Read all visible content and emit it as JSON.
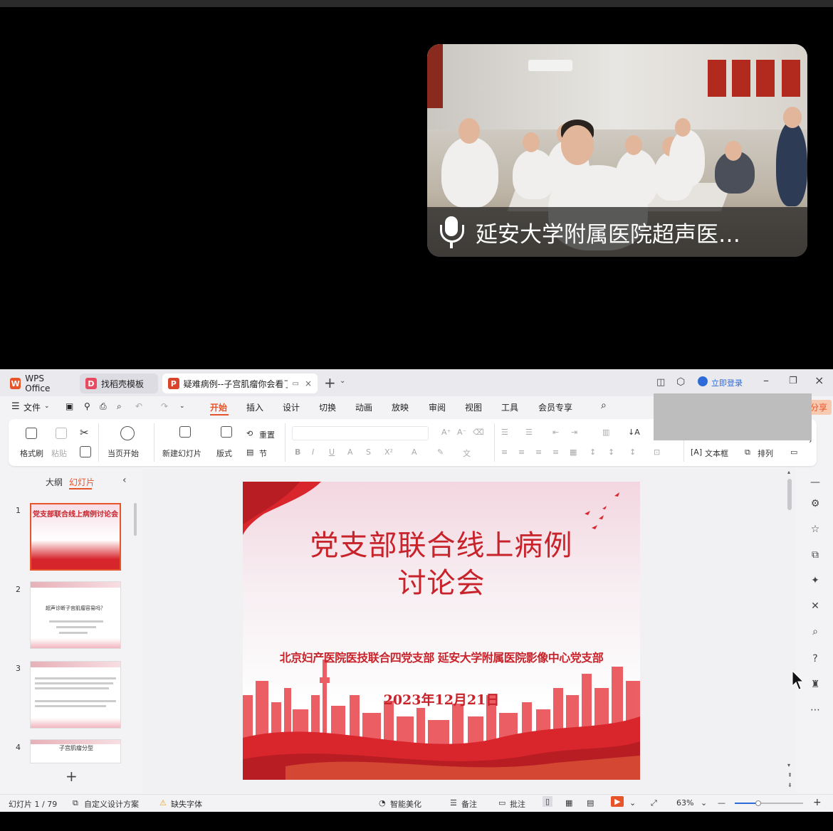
{
  "video": {
    "participant_name": "延安大学附属医院超声医…"
  },
  "tabs": [
    {
      "label": "WPS Office"
    },
    {
      "label": "找稻壳模板"
    },
    {
      "label": "疑难病例--子宫肌瘤你会看了吗"
    }
  ],
  "titlebar": {
    "login": "立即登录"
  },
  "menu": {
    "file": "文件",
    "items": [
      "开始",
      "插入",
      "设计",
      "切换",
      "动画",
      "放映",
      "审阅",
      "视图",
      "工具",
      "会员专享"
    ],
    "share": "分享"
  },
  "ribbon": {
    "format_painter": "格式刷",
    "paste": "粘贴",
    "from_current": "当页开始",
    "new_slide": "新建幻灯片",
    "layout": "版式",
    "reset": "重置",
    "section": "节",
    "textbox": "文本框",
    "arrange": "排列"
  },
  "left_panel": {
    "outline_tab": "大纲",
    "slides_tab": "幻灯片",
    "thumbnails": [
      {
        "num": "1",
        "title": "党支部联合线上病例讨论会"
      },
      {
        "num": "2",
        "title": "超声诊断子宫肌瘤容易吗？"
      },
      {
        "num": "3",
        "title": ""
      },
      {
        "num": "4",
        "title": "子宫肌瘤分型"
      }
    ]
  },
  "slide": {
    "title_line1": "党支部联合线上病例",
    "title_line2": "讨论会",
    "subtitle": "北京妇产医院医技联合四党支部  延安大学附属医院影像中心党支部",
    "date": "2023年12月21日"
  },
  "status": {
    "slide_count": "幻灯片 1 / 79",
    "design": "自定义设计方案",
    "missing_font": "缺失字体",
    "smart_beautify": "智能美化",
    "notes": "备注",
    "comments": "批注",
    "zoom": "63%"
  },
  "colors": {
    "accent_red": "#c8232b",
    "wps_orange": "#e8542a",
    "active_tab": "#e8542a"
  }
}
